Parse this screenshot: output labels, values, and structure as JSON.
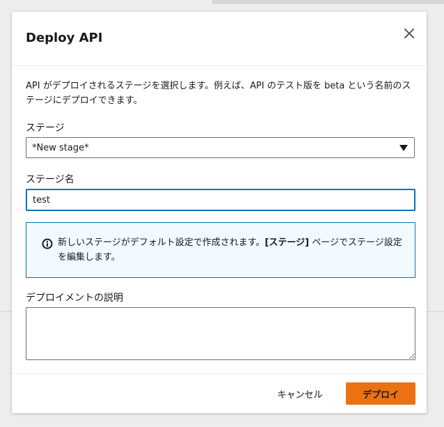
{
  "modal": {
    "title": "Deploy API",
    "description": "API がデプロイされるステージを選択します。例えば、API のテスト版を beta という名前のステージにデプロイできます。"
  },
  "stage_field": {
    "label": "ステージ",
    "selected": "*New stage*"
  },
  "stage_name_field": {
    "label": "ステージ名",
    "value": "test"
  },
  "info": {
    "text_before": "新しいステージがデフォルト設定で作成されます。",
    "text_bold": "[ステージ]",
    "text_after": " ページでステージ設定を編集します。"
  },
  "description_field": {
    "label": "デプロイメントの説明",
    "value": ""
  },
  "footer": {
    "cancel_label": "キャンセル",
    "deploy_label": "デプロイ"
  },
  "colors": {
    "accent": "#ec7211",
    "info_border": "#0073bb",
    "info_bg": "#f1faff"
  },
  "icons": {
    "close": "close-icon",
    "caret": "caret-down-icon",
    "info": "info-icon"
  }
}
